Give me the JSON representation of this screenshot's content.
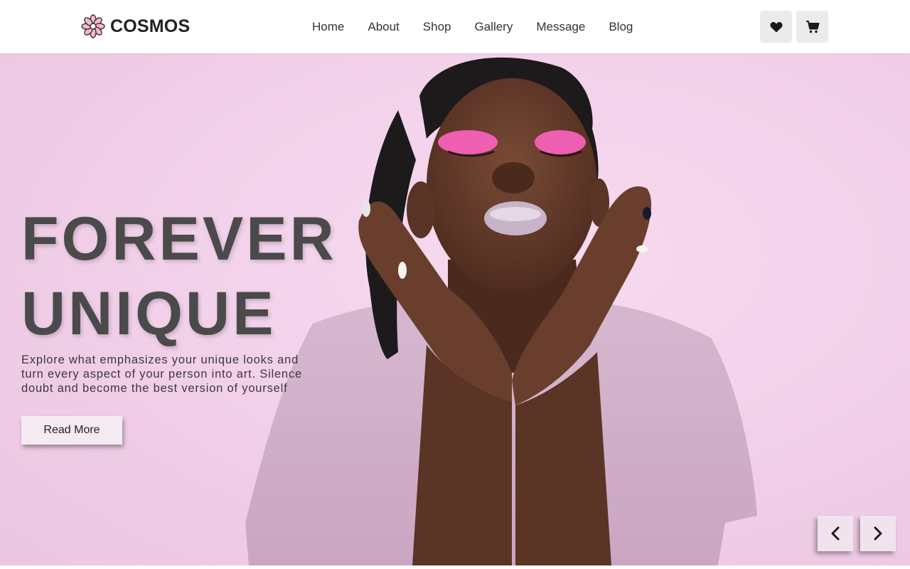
{
  "brand": {
    "name": "COSMOS",
    "logo_icon": "flower-icon"
  },
  "nav": {
    "items": [
      "Home",
      "About",
      "Shop",
      "Gallery",
      "Message",
      "Blog"
    ]
  },
  "header_actions": {
    "wishlist_icon": "heart-icon",
    "cart_icon": "cart-icon"
  },
  "hero": {
    "headline_line1": "FOREVER",
    "headline_line2": "UNIQUE",
    "description": "Explore what emphasizes your unique looks and turn every aspect of your person into art. Silence doubt and become the best version of yourself",
    "cta_label": "Read More",
    "prev_icon": "chevron-left-icon",
    "next_icon": "chevron-right-icon"
  },
  "colors": {
    "hero_background": "#f3d2eb",
    "text_dark": "#4a4a4a",
    "button_background": "#f4eaf2",
    "icon_button_background": "#ebebeb"
  }
}
